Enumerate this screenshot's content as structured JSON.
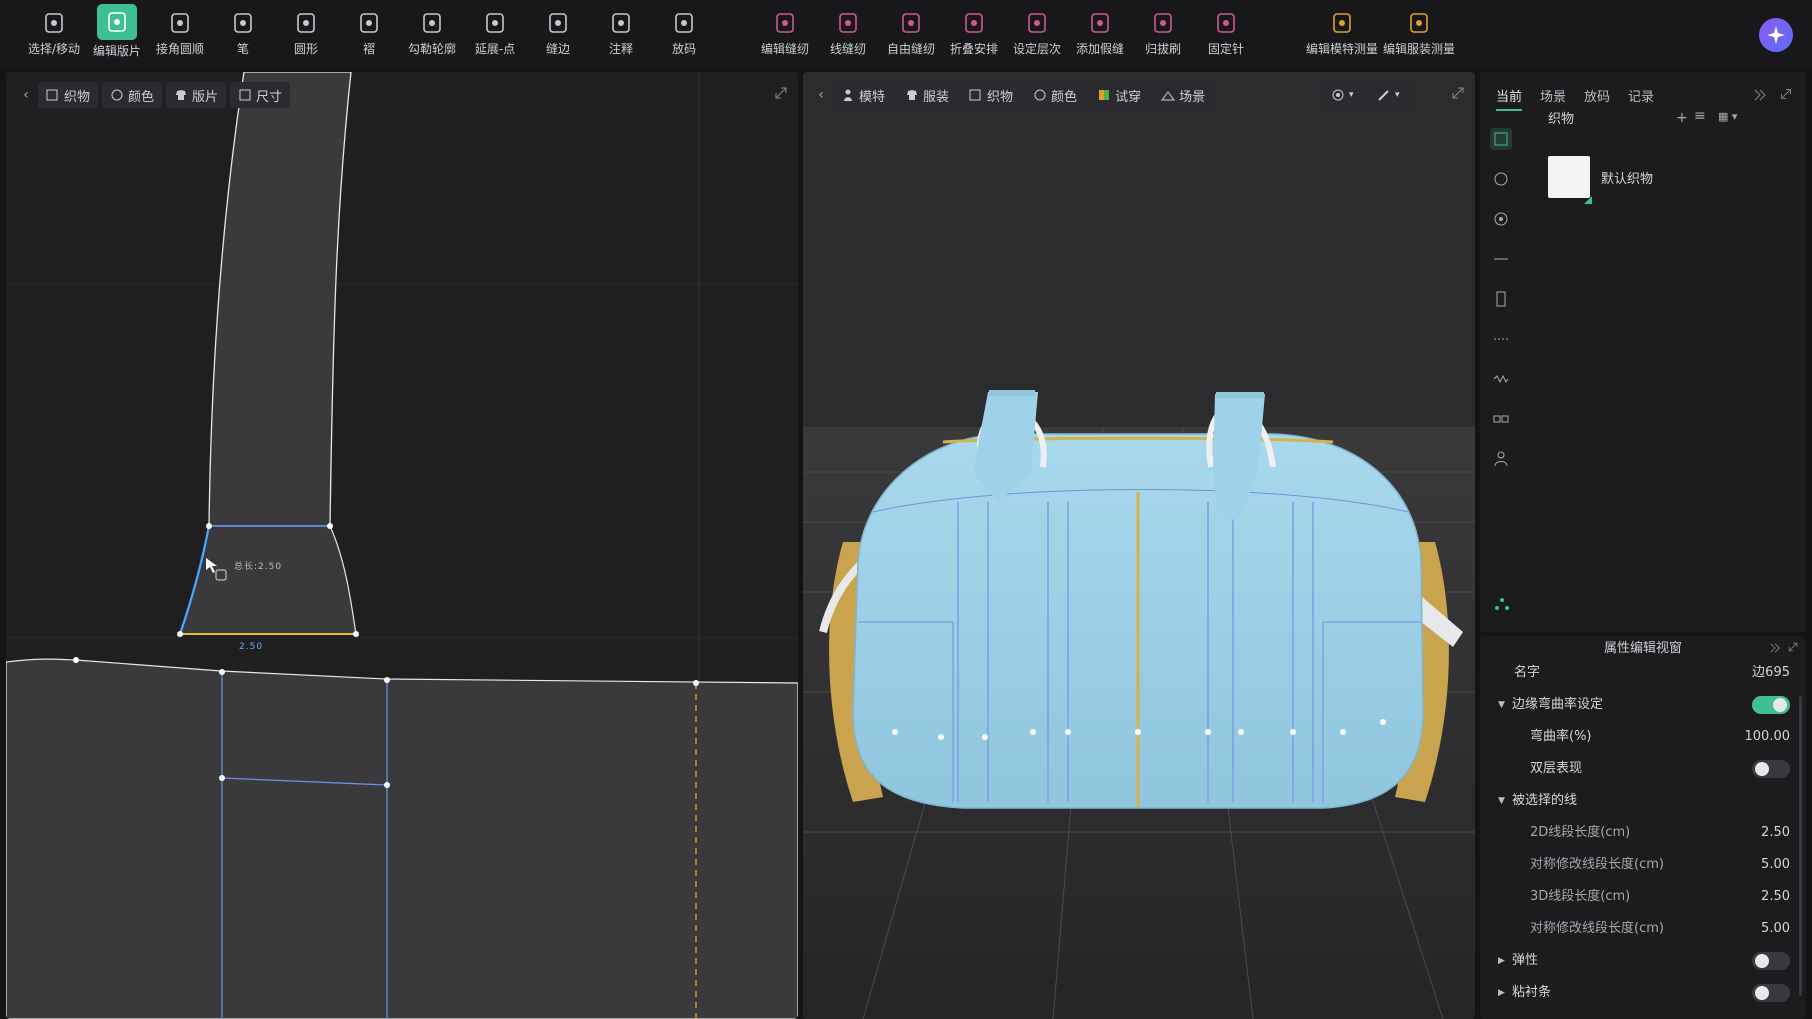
{
  "toolbar": {
    "tools": [
      {
        "label": "选择/移动",
        "icon": "select-move-icon"
      },
      {
        "label": "编辑版片",
        "icon": "edit-pattern-icon",
        "active": true
      },
      {
        "label": "接角圆顺",
        "icon": "corner-smooth-icon"
      },
      {
        "label": "笔",
        "icon": "pen-icon"
      },
      {
        "label": "圆形",
        "icon": "circle-icon"
      },
      {
        "label": "褶",
        "icon": "pleat-icon"
      },
      {
        "label": "勾勒轮廓",
        "icon": "trace-outline-icon"
      },
      {
        "label": "延展-点",
        "icon": "extend-point-icon"
      },
      {
        "label": "缝边",
        "icon": "seam-allowance-icon"
      },
      {
        "label": "注释",
        "icon": "annotation-icon"
      },
      {
        "label": "放码",
        "icon": "grading-icon"
      },
      {
        "label": "编辑缝纫",
        "icon": "edit-sewing-icon"
      },
      {
        "label": "线缝纫",
        "icon": "line-sewing-icon"
      },
      {
        "label": "自由缝纫",
        "icon": "free-sewing-icon"
      },
      {
        "label": "折叠安排",
        "icon": "fold-arrange-icon"
      },
      {
        "label": "设定层次",
        "icon": "set-layer-icon"
      },
      {
        "label": "添加假缝",
        "icon": "add-basting-icon"
      },
      {
        "label": "归拔刷",
        "icon": "shrink-brush-icon"
      },
      {
        "label": "固定针",
        "icon": "pin-icon"
      },
      {
        "label": "编辑模特测量",
        "icon": "avatar-measure-icon"
      },
      {
        "label": "编辑服装测量",
        "icon": "garment-measure-icon"
      }
    ],
    "accent": "#3fbf95"
  },
  "pane2d": {
    "buttons": [
      "织物",
      "颜色",
      "版片",
      "尺寸"
    ],
    "length_label": "总长:2.50",
    "seg_label": "2.50"
  },
  "pane3d": {
    "buttons": [
      "模特",
      "服装",
      "织物",
      "颜色",
      "试穿",
      "场景"
    ]
  },
  "rpanel": {
    "tabs": [
      "当前",
      "场景",
      "放码",
      "记录"
    ],
    "section": "织物",
    "fabric_name": "默认织物"
  },
  "props": {
    "title": "属性编辑视窗",
    "name_label": "名字",
    "name_value": "边695",
    "curv_section": "边缘弯曲率设定",
    "curv_label": "弯曲率(%)",
    "curv_value": "100.00",
    "double_label": "双层表现",
    "sel_section": "被选择的线",
    "len2d_label": "2D线段长度(cm)",
    "len2d_value": "2.50",
    "sym2d_label": "对称修改线段长度(cm)",
    "sym2d_value": "5.00",
    "len3d_label": "3D线段长度(cm)",
    "len3d_value": "2.50",
    "sym3d_label": "对称修改线段长度(cm)",
    "sym3d_value": "5.00",
    "elastic_label": "弹性",
    "tape_label": "粘衬条"
  }
}
